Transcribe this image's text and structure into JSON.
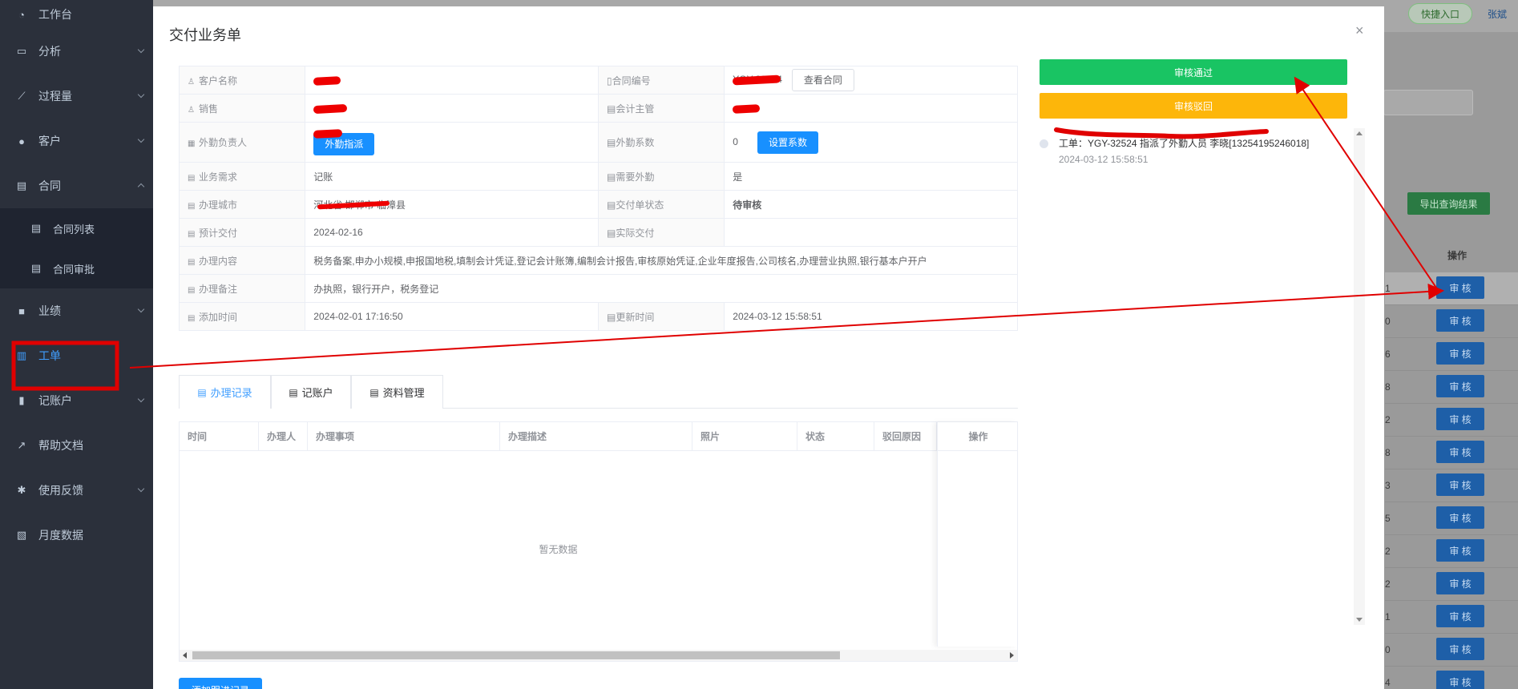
{
  "sidebar": {
    "items": [
      {
        "label": "工作台",
        "icon": "dashboard-icon"
      },
      {
        "label": "分析",
        "icon": "chart-icon"
      },
      {
        "label": "过程量",
        "icon": "trend-icon"
      },
      {
        "label": "客户",
        "icon": "user-icon"
      },
      {
        "label": "合同",
        "icon": "document-icon"
      },
      {
        "label": "合同列表",
        "icon": "document-icon"
      },
      {
        "label": "合同审批",
        "icon": "document-icon"
      },
      {
        "label": "业绩",
        "icon": "briefcase-icon"
      },
      {
        "label": "工单",
        "icon": "clipboard-icon"
      },
      {
        "label": "记账户",
        "icon": "book-icon"
      },
      {
        "label": "帮助文档",
        "icon": "external-link-icon"
      },
      {
        "label": "使用反馈",
        "icon": "bug-icon"
      },
      {
        "label": "月度数据",
        "icon": "line-chart-icon"
      }
    ]
  },
  "background": {
    "quick_entry": "快捷入口",
    "user_name": "张斌",
    "export_label": "导出查询结果",
    "op_header": "操作",
    "audit_label": "审 核",
    "row_suffixes": [
      "1",
      "0",
      "6",
      "8",
      "2",
      "8",
      "3",
      "5",
      "2",
      "2",
      "1",
      "0",
      "4"
    ]
  },
  "modal": {
    "title": "交付业务单",
    "close": "×",
    "fields": {
      "customer_name_label": "客户名称",
      "contract_no_label": "合同编号",
      "contract_no_value": "YGY-32524",
      "view_contract": "查看合同",
      "sales_label": "销售",
      "accounting_supervisor_label": "会计主管",
      "field_person_label": "外勤负责人",
      "field_dispatch": "外勤指派",
      "field_coefficient_label": "外勤系数",
      "field_coefficient_value": "0",
      "set_coefficient": "设置系数",
      "business_need_label": "业务需求",
      "business_need_value": "记账",
      "need_field_label": "需要外勤",
      "need_field_value": "是",
      "city_label": "办理城市",
      "city_value": "河北省 邯郸市 临漳县",
      "status_label": "交付单状态",
      "status_value": "待审核",
      "planned_delivery_label": "预计交付",
      "planned_delivery_value": "2024-02-16",
      "actual_delivery_label": "实际交付",
      "content_label": "办理内容",
      "content_value": "税务备案,申办小规模,申报国地税,填制会计凭证,登记会计账簿,编制会计报告,审核原始凭证,企业年度报告,公司核名,办理营业执照,银行基本户开户",
      "remark_label": "办理备注",
      "remark_value": "办执照，银行开户，税务登记",
      "created_label": "添加时间",
      "created_value": "2024-02-01 17:16:50",
      "updated_label": "更新时间",
      "updated_value": "2024-03-12 15:58:51"
    },
    "tabs": [
      "办理记录",
      "记账户",
      "资料管理"
    ],
    "grid": {
      "columns": [
        "时间",
        "办理人",
        "办理事项",
        "办理描述",
        "照片",
        "状态",
        "驳回原因"
      ],
      "fixed_column": "操作",
      "empty_text": "暂无数据"
    },
    "add_record": "添加跟进记录",
    "approve": "审核通过",
    "reject": "审核驳回",
    "timeline": {
      "text": "工单：YGY-32524 指派了外勤人员 李晓[13254195246018]",
      "time": "2024-03-12 15:58:51"
    }
  },
  "colors": {
    "sidebar_bg": "#2b303b",
    "primary": "#1890ff",
    "approve": "#19c463",
    "reject": "#fdb60a",
    "annotation": "#e00000"
  }
}
